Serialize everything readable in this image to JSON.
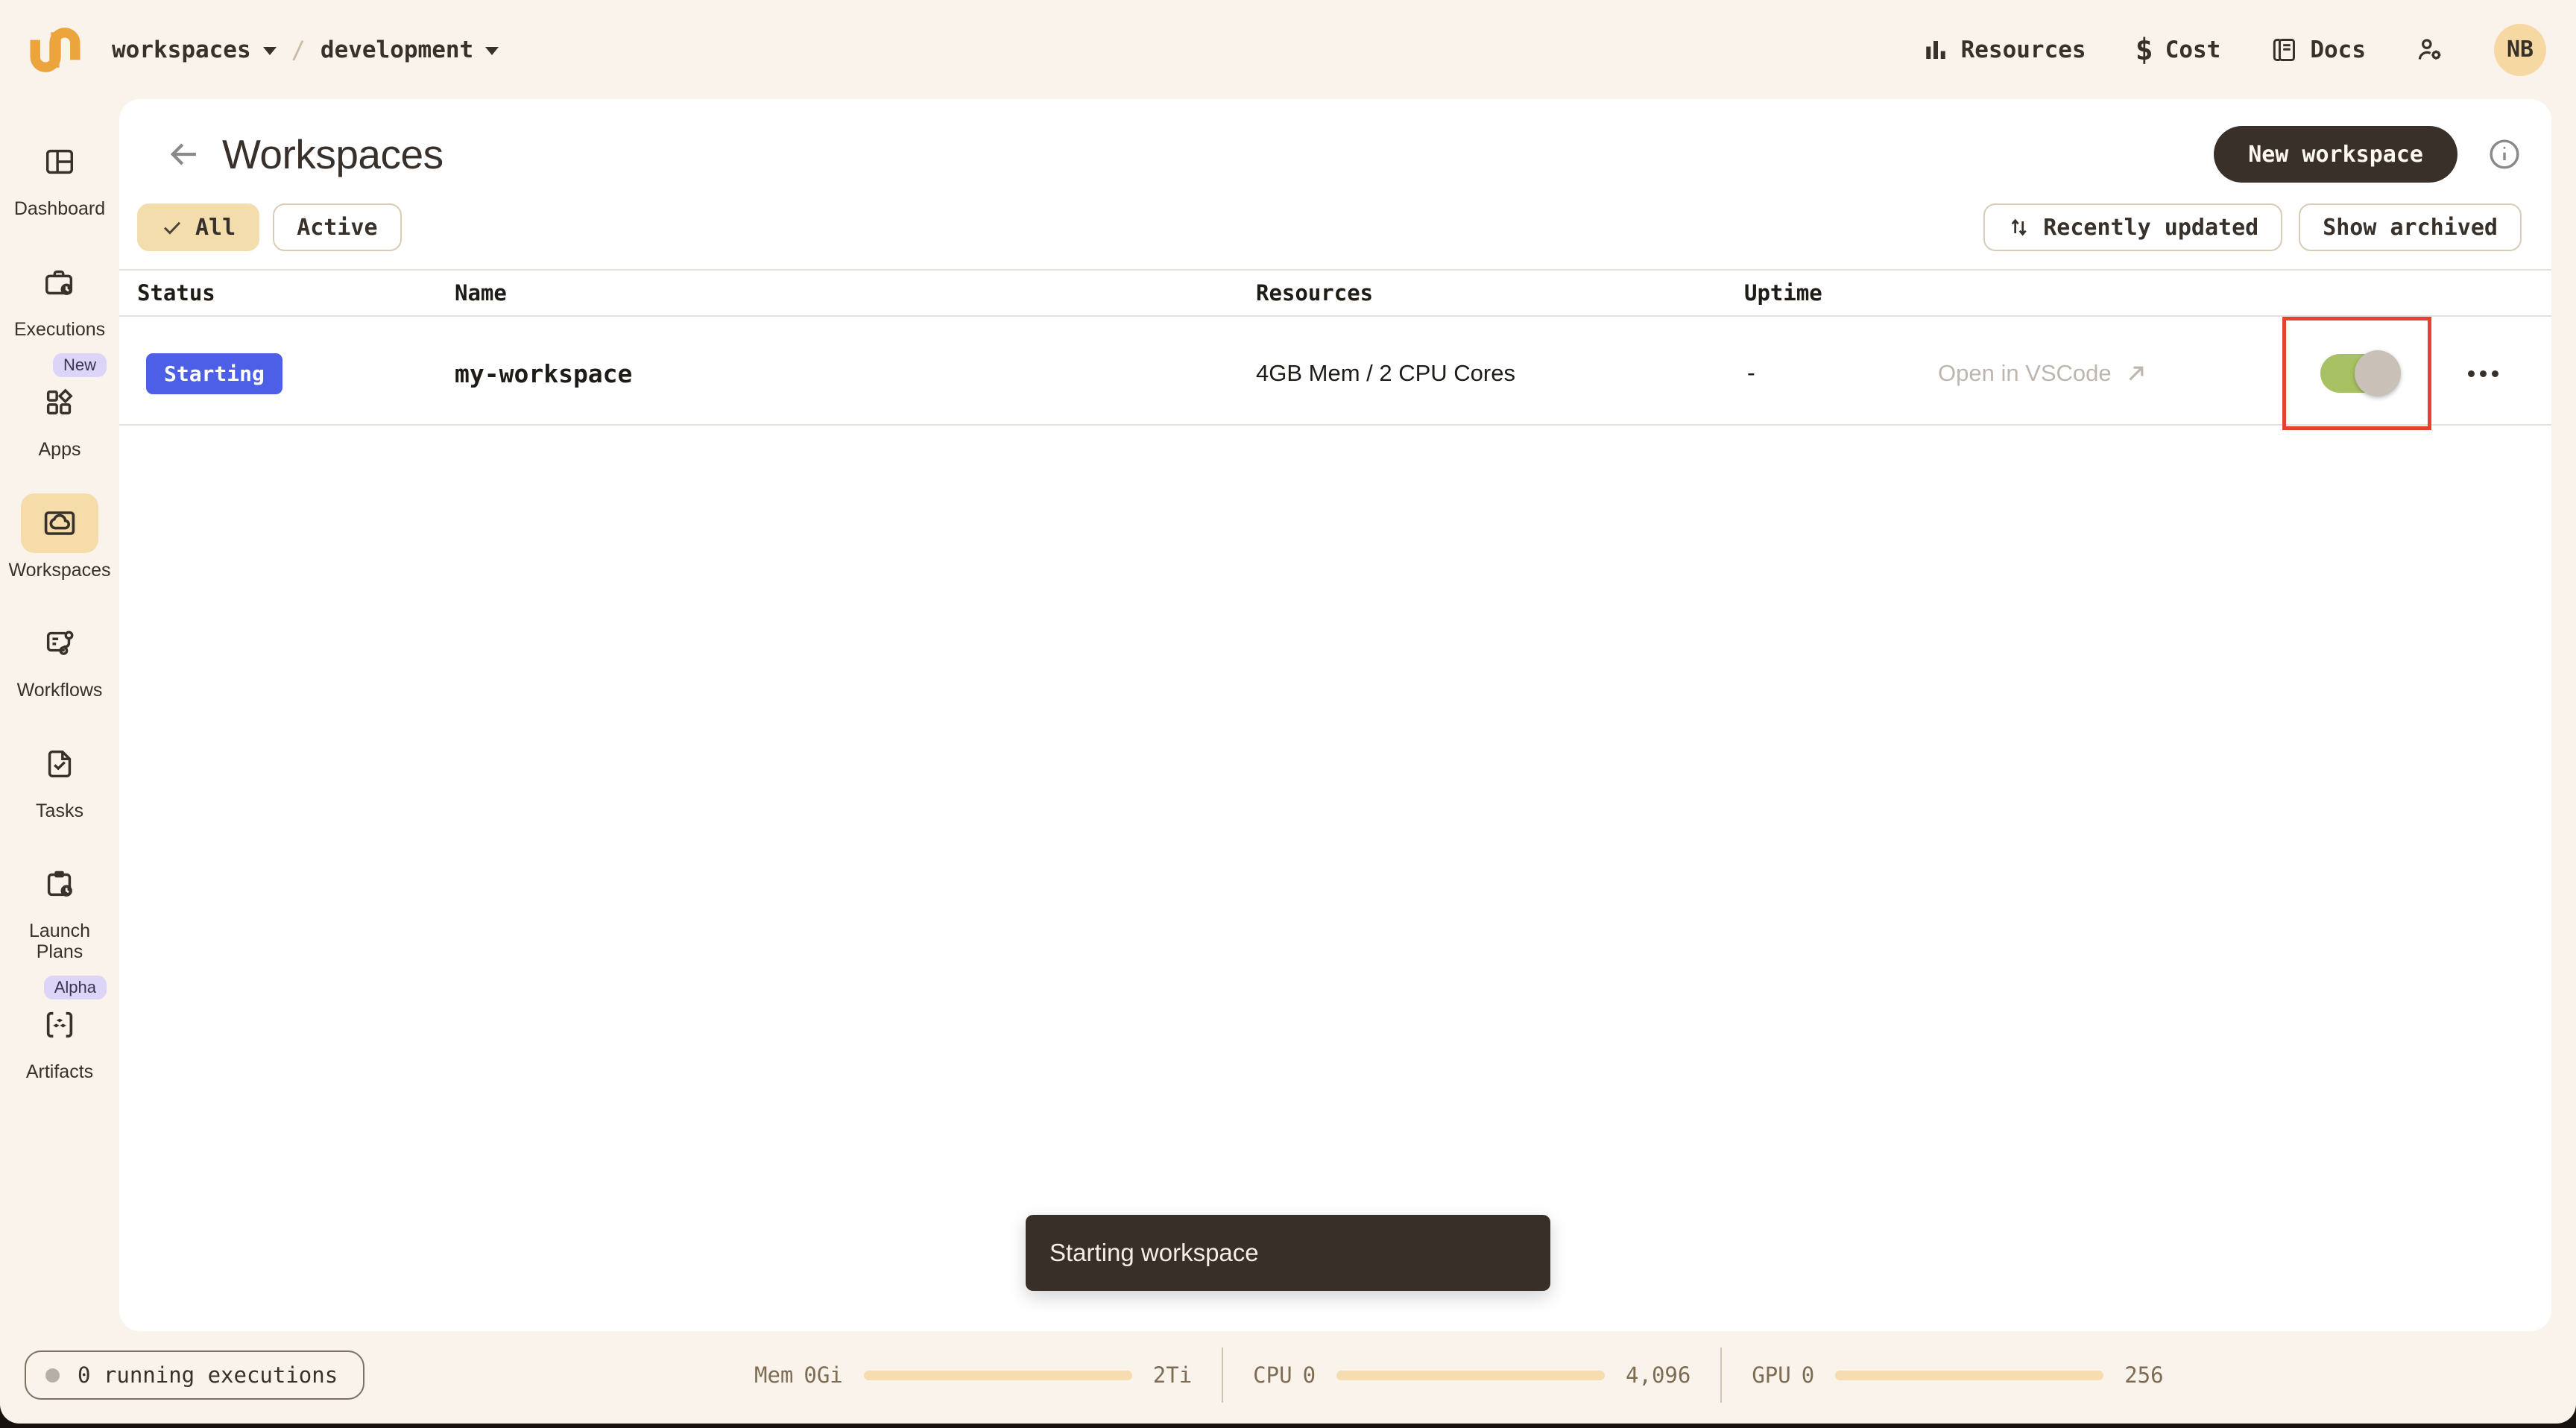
{
  "topbar": {
    "breadcrumb": {
      "project": "workspaces",
      "separator": "/",
      "domain": "development"
    },
    "nav": {
      "resources": "Resources",
      "cost": "Cost",
      "docs": "Docs"
    },
    "cost_icon_glyph": "$",
    "avatar_initials": "NB"
  },
  "sidebar": {
    "items": [
      {
        "label": "Dashboard"
      },
      {
        "label": "Executions"
      },
      {
        "label": "Apps",
        "badge": "New"
      },
      {
        "label": "Workspaces",
        "active": true
      },
      {
        "label": "Workflows"
      },
      {
        "label": "Tasks"
      },
      {
        "label": "Launch Plans"
      },
      {
        "label": "Artifacts",
        "badge": "Alpha"
      }
    ]
  },
  "header": {
    "title": "Workspaces",
    "new_workspace_label": "New workspace"
  },
  "filters": {
    "all": "All",
    "active": "Active",
    "sort": "Recently updated",
    "archived": "Show archived"
  },
  "table": {
    "columns": [
      "Status",
      "Name",
      "Resources",
      "Uptime"
    ],
    "rows": [
      {
        "status": "Starting",
        "name": "my-workspace",
        "resources": "4GB Mem / 2 CPU Cores",
        "uptime": "-",
        "action": "Open in VSCode",
        "toggle_on": true
      }
    ]
  },
  "toast": {
    "message": "Starting workspace"
  },
  "statusbar": {
    "executions": "0 running executions",
    "meters": [
      {
        "label": "Mem",
        "used": "0Gi",
        "capacity": "2Ti"
      },
      {
        "label": "CPU",
        "used": "0",
        "capacity": "4,096"
      },
      {
        "label": "GPU",
        "used": "0",
        "capacity": "256"
      }
    ]
  },
  "colors": {
    "background": "#FAF3EC",
    "panel": "#FFFFFF",
    "ink": "#38302A",
    "accent_orange": "#ECA43D",
    "active_fill": "#F4DDAC",
    "badge_blue": "#4C5FE6",
    "badge_lavender": "#DCD5F8",
    "toggle_green": "#A8C162",
    "toggle_knob": "#C9C1B8",
    "annotation_red": "#E6412E",
    "toast_bg": "#382F29",
    "meter_bar": "#F5DDB0"
  }
}
